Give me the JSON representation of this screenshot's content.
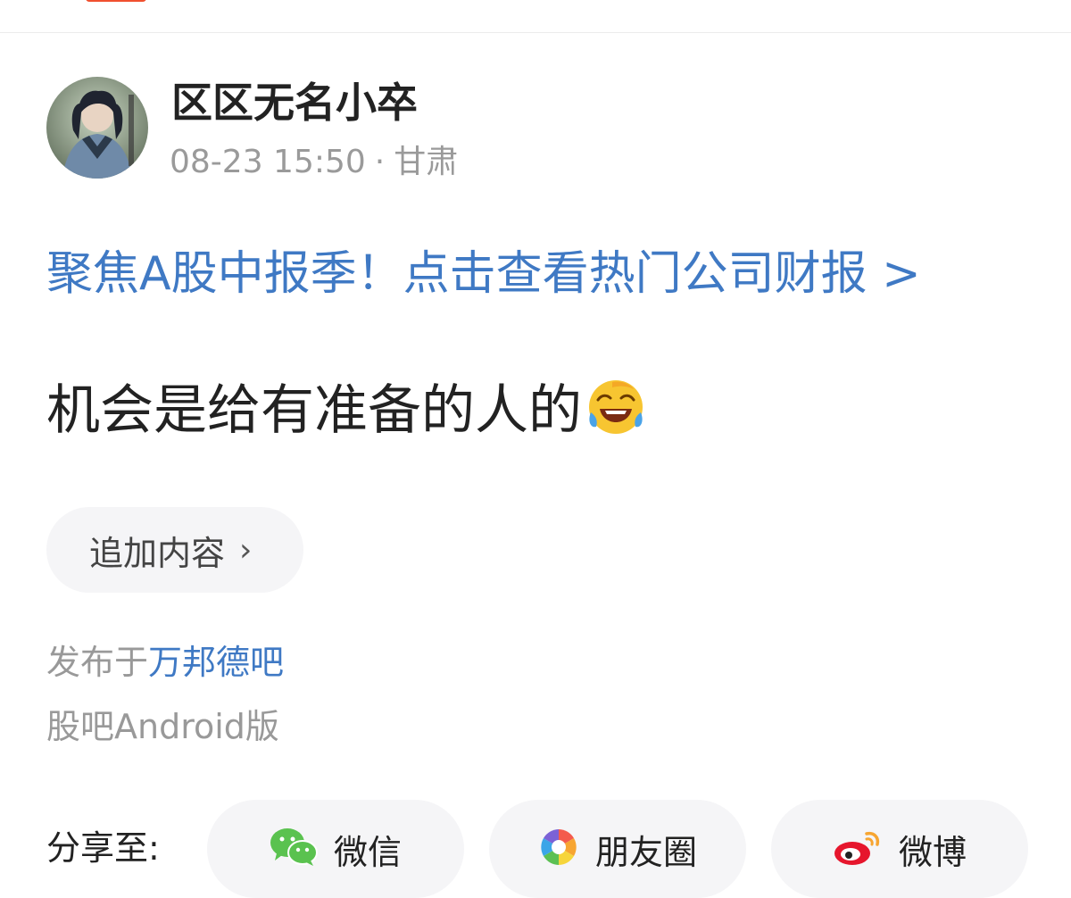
{
  "post": {
    "author": "区区无名小卒",
    "time": "08-23 15:50",
    "separator": "·",
    "location": "甘肃",
    "promo_link": "聚焦A股中报季！点击查看热门公司财报 >",
    "content": "机会是给有准备的人的",
    "add_content_label": "追加内容",
    "add_content_chevron": "›",
    "posted_in_prefix": "发布于",
    "forum_name": "万邦德吧",
    "client": "股吧Android版"
  },
  "share": {
    "label": "分享至:",
    "wechat": "微信",
    "moments": "朋友圈",
    "weibo": "微博"
  },
  "icons": {
    "avatar": "user-avatar",
    "emoji": "laughing-emoji-icon",
    "wechat": "wechat-icon",
    "moments": "moments-icon",
    "weibo": "weibo-icon"
  },
  "colors": {
    "link": "#3f79c4",
    "muted": "#9a9a9a",
    "accent": "#f0502f"
  }
}
